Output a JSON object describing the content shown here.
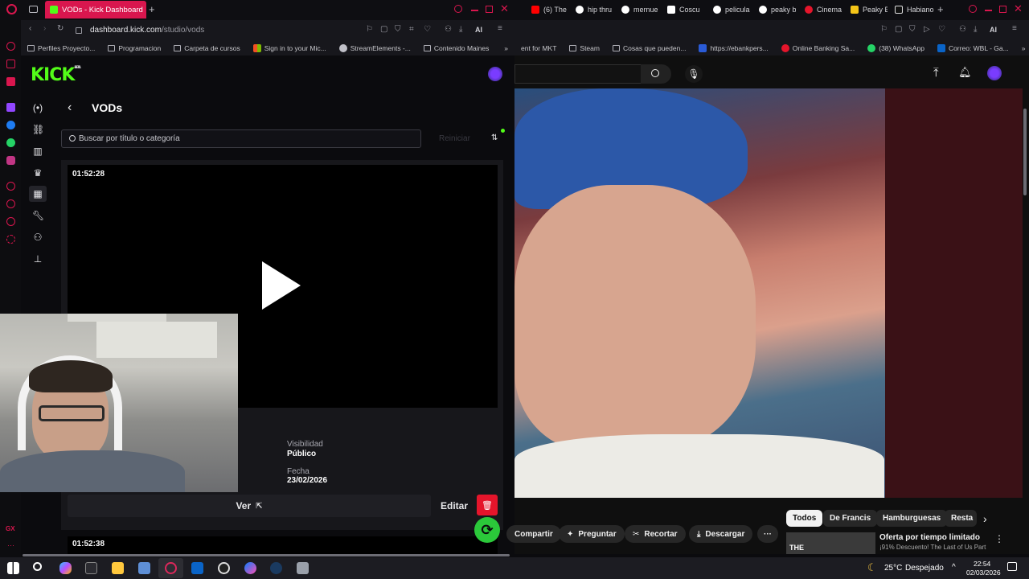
{
  "browser": {
    "tabs_left": [
      {
        "label": "VODs - Kick Dashboard",
        "active": true,
        "color": "#53fc18"
      }
    ],
    "tabs_right": [
      {
        "label": "(6) The",
        "color": "#ff0000"
      },
      {
        "label": "hip thru",
        "color": "#e6e6ea"
      },
      {
        "label": "mernue",
        "color": "#e6e6ea"
      },
      {
        "label": "Coscu",
        "color": "#e6e6ea"
      },
      {
        "label": "pelicula",
        "color": "#e6e6ea"
      },
      {
        "label": "peaky b",
        "color": "#e6e6ea"
      },
      {
        "label": "Cinema",
        "color": "#e5152b"
      },
      {
        "label": "Peaky B",
        "color": "#f5c518"
      },
      {
        "label": "Habiano",
        "color": "#e6e6ea"
      }
    ],
    "url_host": "dashboard.kick.com",
    "url_path": "/studio/vods",
    "ai_label": "AI",
    "bookmarks_left": [
      "Perfiles Proyecto...",
      "Programacion",
      "Carpeta de cursos",
      "Sign in to your Mic...",
      "StreamElements -...",
      "Contenido Maines"
    ],
    "bookmarks_right": [
      "ent for MKT",
      "Steam",
      "Cosas que pueden...",
      "https://ebankpers...",
      "Online Banking Sa...",
      "(38) WhatsApp",
      "Correo: WBL - Ga..."
    ]
  },
  "kick": {
    "logo": "KICK",
    "logo_badge": "BETA",
    "page_title": "VODs",
    "search_placeholder": "Buscar por título o categoría",
    "reset_label": "Reiniciar",
    "vod1": {
      "duration": "01:52:28",
      "visibility_label": "Visibilidad",
      "visibility_value": "Público",
      "date_label": "Fecha",
      "date_value": "23/02/2026",
      "view_label": "Ver",
      "edit_label": "Editar"
    },
    "vod2": {
      "duration": "01:52:38"
    }
  },
  "youtube": {
    "chips": [
      "Todos",
      "De Francis",
      "Hamburguesas",
      "Resta"
    ],
    "actions": [
      "Compartir",
      "Preguntar",
      "Recortar",
      "Descargar"
    ],
    "rec_title": "Oferta por tiempo limitado",
    "rec_subtitle": "¡91% Descuento! The Last of Us Part",
    "rec_thumb_text": "THE"
  },
  "taskbar": {
    "weather": "25°C",
    "weather_desc": "Despejado",
    "time": "22:54",
    "date": "02/03/2026"
  },
  "colors": {
    "kick_green": "#53fc18",
    "opera_red": "#d9164e",
    "danger": "#e5152b"
  }
}
